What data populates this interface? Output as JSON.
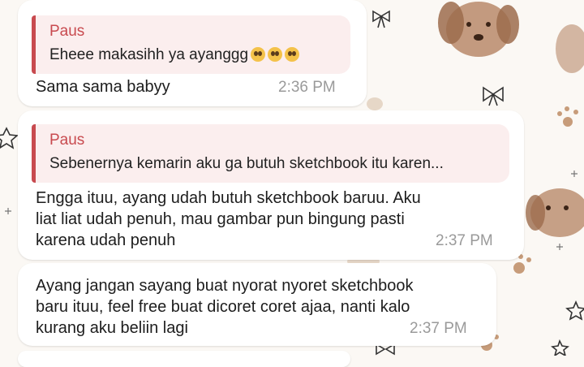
{
  "messages": [
    {
      "quote_author": "Paus",
      "quote_text": "Eheee makasihh ya ayanggg",
      "text": "Sama sama babyy",
      "time": "2:36 PM"
    },
    {
      "quote_author": "Paus",
      "quote_text": "Sebenernya kemarin aku ga butuh sketchbook itu karen...",
      "text": "Engga ituu, ayang udah butuh sketchbook baruu. Aku\nliat liat udah penuh, mau gambar pun bingung pasti\nkarena udah penuh",
      "time": "2:37 PM"
    },
    {
      "text": "Ayang jangan sayang buat nyorat nyoret sketchbook\nbaru ituu, feel free buat dicoret coret ajaa, nanti kalo\nkurang aku beliin lagi",
      "time": "2:37 PM"
    }
  ],
  "colors": {
    "quote_accent": "#c84a4f",
    "quote_bg": "#fbeeee",
    "time": "#9a9a9a"
  }
}
